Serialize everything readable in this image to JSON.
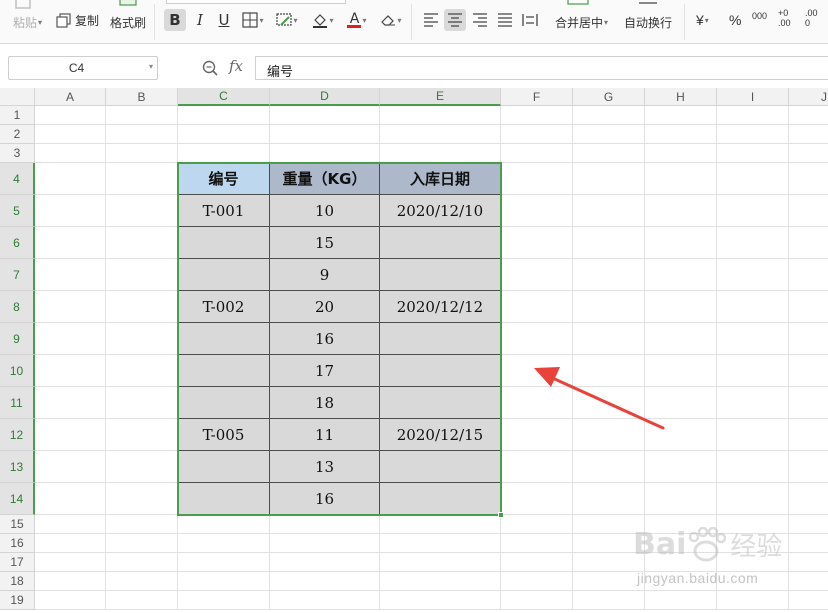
{
  "ribbon": {
    "paste_label": "粘贴",
    "copy_label": "复制",
    "format_painter_label": "格式刷",
    "bold_label": "B",
    "italic_label": "I",
    "underline_label": "U",
    "font_color_label": "A",
    "merge_center_label": "合并居中",
    "wrap_text_label": "自动换行",
    "currency_label": "¥",
    "percent_label": "%",
    "thousands_label": "000",
    "inc_decimal_label": "+0\n.00",
    "dec_decimal_label": ".00\n0"
  },
  "formula_bar": {
    "name_box": "C4",
    "fx_label": "fx",
    "formula": "编号"
  },
  "columns": [
    "A",
    "B",
    "C",
    "D",
    "E",
    "F",
    "G",
    "H",
    "I",
    "J"
  ],
  "rows": [
    "1",
    "2",
    "3",
    "4",
    "5",
    "6",
    "7",
    "8",
    "9",
    "10",
    "11",
    "12",
    "13",
    "14",
    "15",
    "16",
    "17",
    "18",
    "19"
  ],
  "table": {
    "headers": [
      "编号",
      "重量（KG）",
      "入库日期"
    ],
    "rows": [
      [
        "T-001",
        "10",
        "2020/12/10"
      ],
      [
        "",
        "15",
        ""
      ],
      [
        "",
        "9",
        ""
      ],
      [
        "T-002",
        "20",
        "2020/12/12"
      ],
      [
        "",
        "16",
        ""
      ],
      [
        "",
        "17",
        ""
      ],
      [
        "",
        "18",
        ""
      ],
      [
        "T-005",
        "11",
        "2020/12/15"
      ],
      [
        "",
        "13",
        ""
      ],
      [
        "",
        "16",
        ""
      ]
    ]
  },
  "watermark": {
    "brand": "Bai",
    "brand_suffix": "经验",
    "url": "jingyan.baidu.com"
  },
  "colors": {
    "selection": "#4a9d4a",
    "header_fill_blue": "#bdd7ee",
    "header_fill_grey": "#adb9ca",
    "table_fill": "#d9d9d9",
    "arrow": "#e8423a"
  }
}
